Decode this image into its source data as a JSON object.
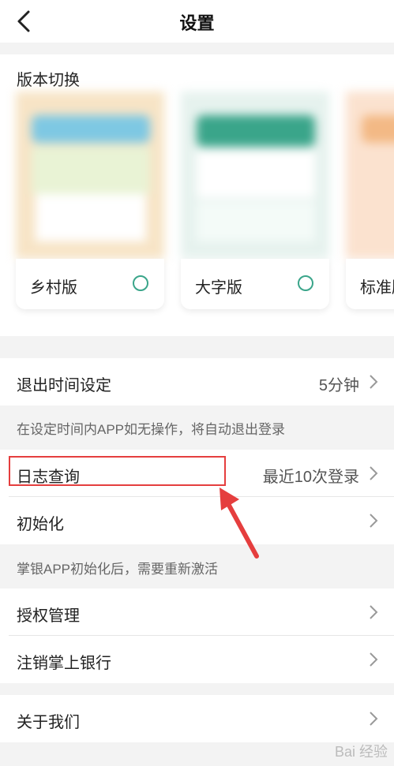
{
  "nav": {
    "title": "设置",
    "back_icon": "back-arrow-icon"
  },
  "version_section": {
    "title": "版本切换",
    "cards": [
      {
        "label": "乡村版",
        "accent": "#7ec8e3",
        "bg": "#f7e4c6"
      },
      {
        "label": "大字版",
        "accent": "#3aa58a",
        "bg": "#e6f2ee"
      },
      {
        "label": "标准版",
        "accent": "#f3b985",
        "bg": "#fbe2cf"
      }
    ]
  },
  "settings": {
    "logout_time": {
      "label": "退出时间设定",
      "value": "5分钟"
    },
    "logout_note": "在设定时间内APP如无操作，将自动退出登录",
    "log_query": {
      "label": "日志查询",
      "value": "最近10次登录"
    },
    "init": {
      "label": "初始化"
    },
    "init_note": "掌银APP初始化后，需要重新激活",
    "auth": {
      "label": "授权管理"
    },
    "cancel_bank": {
      "label": "注销掌上银行"
    },
    "about": {
      "label": "关于我们"
    }
  },
  "colors": {
    "highlight": "#e53e3e",
    "radio": "#3aa58a"
  },
  "watermark": "Bai 经验"
}
